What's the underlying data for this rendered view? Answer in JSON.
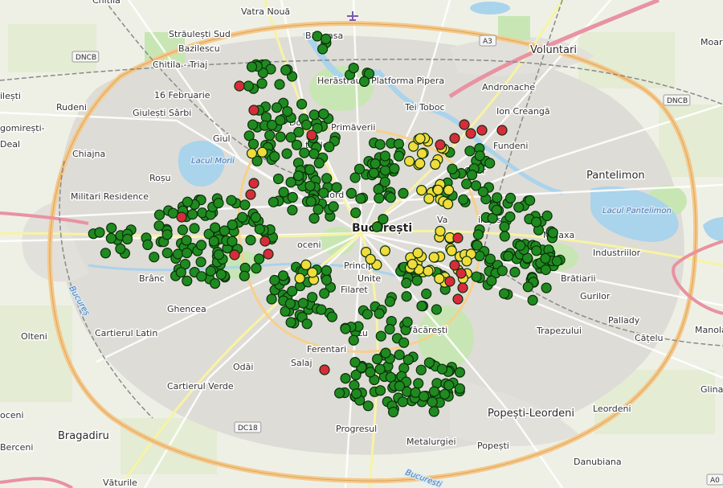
{
  "map": {
    "place_labels": [
      {
        "id": "vatra-noua",
        "text": "Vatra Nouă",
        "kind": "normal"
      },
      {
        "id": "straulesti-sud",
        "text": "Străulești Sud",
        "kind": "normal"
      },
      {
        "id": "bazilescu",
        "text": "Bazilescu",
        "kind": "normal"
      },
      {
        "id": "baneasa",
        "text": "Băneasa",
        "kind": "normal"
      },
      {
        "id": "voluntari",
        "text": "Voluntari",
        "kind": "big"
      },
      {
        "id": "chitila-triaj",
        "text": "Chitila - Triaj",
        "kind": "normal"
      },
      {
        "id": "herastrau",
        "text": "Herăstrău",
        "kind": "normal"
      },
      {
        "id": "platforma-pipera",
        "text": "Platforma Pipera",
        "kind": "normal"
      },
      {
        "id": "andronache",
        "text": "Andronache",
        "kind": "normal"
      },
      {
        "id": "16-februarie",
        "text": "16 Februarie",
        "kind": "normal"
      },
      {
        "id": "tei-toboc",
        "text": "Tei Toboc",
        "kind": "normal"
      },
      {
        "id": "ion-creanga",
        "text": "Ion Creangă",
        "kind": "normal"
      },
      {
        "id": "rudeni",
        "text": "Rudeni",
        "kind": "normal"
      },
      {
        "id": "giulesti-sarbi",
        "text": "Giulești Sârbi",
        "kind": "normal"
      },
      {
        "id": "domenii",
        "text": "Domenii",
        "kind": "normal"
      },
      {
        "id": "primaverii",
        "text": "Primăverii",
        "kind": "normal"
      },
      {
        "id": "fundeni",
        "text": "Fundeni",
        "kind": "normal"
      },
      {
        "id": "dudesti-cioplea",
        "text": "gomirești-",
        "kind": "normal"
      },
      {
        "id": "deal",
        "text": "Deal",
        "kind": "normal"
      },
      {
        "id": "chiajna",
        "text": "Chiajna",
        "kind": "normal"
      },
      {
        "id": "giulesti",
        "text": "Giul",
        "kind": "normal"
      },
      {
        "id": "aviatorilor",
        "text": "torilor",
        "kind": "normal"
      },
      {
        "id": "lacul-morii",
        "text": "Lacul Morii",
        "kind": "water"
      },
      {
        "id": "rosu",
        "text": "Roșu",
        "kind": "normal"
      },
      {
        "id": "pantelimon",
        "text": "Pantelimon",
        "kind": "big"
      },
      {
        "id": "militari-residence",
        "text": "Militari Residence",
        "kind": "normal"
      },
      {
        "id": "gara-de-nord",
        "text": "Nord",
        "kind": "normal"
      },
      {
        "id": "lacul-pantelimon",
        "text": "Lacul Pantelimon",
        "kind": "water"
      },
      {
        "id": "bucuresti",
        "text": "București",
        "kind": "city"
      },
      {
        "id": "obor",
        "text": "Obor",
        "kind": "normal"
      },
      {
        "id": "vatra-luminoasa",
        "text": "Va",
        "kind": "normal"
      },
      {
        "id": "vatra-luminoasa-2",
        "text": "inoas",
        "kind": "normal"
      },
      {
        "id": "malaxa",
        "text": "Malaxa",
        "kind": "normal"
      },
      {
        "id": "industriilor",
        "text": "Industriilor",
        "kind": "normal"
      },
      {
        "id": "cotroceni",
        "text": "oceni",
        "kind": "normal"
      },
      {
        "id": "brancoveanu",
        "text": "Brânc",
        "kind": "normal"
      },
      {
        "id": "universitate",
        "text": "Unite",
        "kind": "normal"
      },
      {
        "id": "principala",
        "text": "Principa",
        "kind": "normal"
      },
      {
        "id": "bratiarii",
        "text": "Brătiarii",
        "kind": "normal"
      },
      {
        "id": "ghencea",
        "text": "Ghencea",
        "kind": "normal"
      },
      {
        "id": "filaret",
        "text": "Filaret",
        "kind": "normal"
      },
      {
        "id": "gurilor",
        "text": "Gurilor",
        "kind": "normal"
      },
      {
        "id": "pallady",
        "text": "Pallady",
        "kind": "normal"
      },
      {
        "id": "manolache",
        "text": "Manola",
        "kind": "normal"
      },
      {
        "id": "olteni",
        "text": "Olteni",
        "kind": "normal"
      },
      {
        "id": "cartierul-latin",
        "text": "Cartierul Latin",
        "kind": "normal"
      },
      {
        "id": "vacaresti",
        "text": "Văcărești",
        "kind": "normal"
      },
      {
        "id": "trapezului",
        "text": "Trapezului",
        "kind": "normal"
      },
      {
        "id": "catelu",
        "text": "Cățelu",
        "kind": "normal"
      },
      {
        "id": "lu",
        "text": "Lu",
        "kind": "normal"
      },
      {
        "id": "ferentari",
        "text": "Ferentari",
        "kind": "normal"
      },
      {
        "id": "odai",
        "text": "Odăi",
        "kind": "normal"
      },
      {
        "id": "salaj",
        "text": "Salaj",
        "kind": "normal"
      },
      {
        "id": "cartierul-verde",
        "text": "Cartierul Verde",
        "kind": "normal"
      },
      {
        "id": "glina",
        "text": "Glina",
        "kind": "normal"
      },
      {
        "id": "oceni",
        "text": "oceni",
        "kind": "normal"
      },
      {
        "id": "popesti-leordeni",
        "text": "Popești-Leordeni",
        "kind": "big"
      },
      {
        "id": "leordeni",
        "text": "Leordeni",
        "kind": "normal"
      },
      {
        "id": "bragadiru",
        "text": "Bragadiru",
        "kind": "big"
      },
      {
        "id": "progresul",
        "text": "Progresul",
        "kind": "normal"
      },
      {
        "id": "metalurgiei",
        "text": "Metalurgiei",
        "kind": "normal"
      },
      {
        "id": "popesti",
        "text": "Popești",
        "kind": "normal"
      },
      {
        "id": "danubiana",
        "text": "Danubiana",
        "kind": "normal"
      },
      {
        "id": "berceni",
        "text": "Berceni",
        "kind": "normal"
      },
      {
        "id": "moara",
        "text": "Moara",
        "kind": "normal"
      },
      {
        "id": "chitila",
        "text": "Chitila",
        "kind": "normal"
      },
      {
        "id": "vaturile",
        "text": "Văturile",
        "kind": "normal"
      },
      {
        "id": "ilesti",
        "text": "ilești",
        "kind": "normal"
      },
      {
        "id": "bucuresti-road",
        "text": "Bucureș",
        "kind": "road"
      },
      {
        "id": "bucuresti-road-2",
        "text": "Bucuresti",
        "kind": "road"
      }
    ],
    "shields": [
      {
        "id": "dncb-left",
        "text": "DNCB"
      },
      {
        "id": "a3",
        "text": "A3"
      },
      {
        "id": "dncb-right",
        "text": "DNCB"
      },
      {
        "id": "dc18",
        "text": "DC18"
      },
      {
        "id": "a0",
        "text": "A0"
      }
    ],
    "colors": {
      "land": "#eef0e6",
      "urban": "#dedcd6",
      "park": "#c8e6b4",
      "water": "#aad3ec",
      "ring_road": "#f5c88a",
      "motorway": "#e892a2",
      "railway": "#8a8a8a",
      "marker_good": "#1f8a1f",
      "marker_moderate": "#f0dc3a",
      "marker_bad": "#d92b3c"
    },
    "marker_status": [
      "good",
      "moderate",
      "bad"
    ]
  }
}
